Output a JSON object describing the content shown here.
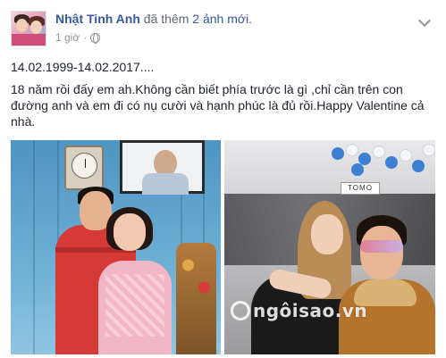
{
  "post": {
    "author": "Nhật Tinh Anh",
    "action_prefix": "đã thêm",
    "photo_link": "2 ảnh mới",
    "action_suffix": ".",
    "timestamp": "1 giờ",
    "separator": "·",
    "privacy_icon": "globe-icon",
    "menu_icon": "chevron-down-icon",
    "dates_line": "14.02.1999-14.02.2017....",
    "body": "18 năm rồi đấy em ah.Không cần biết phía trước là gì ,chỉ cần trên con đường anh và em đi có nụ cười và hạnh phúc là đủ rồi.Happy Valentine cả nhà."
  },
  "photos": {
    "right_store_sign": "TOMO",
    "watermark": "ngôisao.vn"
  },
  "colors": {
    "link_blue": "#365899",
    "meta_gray": "#90949c",
    "text_dark": "#1d2129"
  }
}
